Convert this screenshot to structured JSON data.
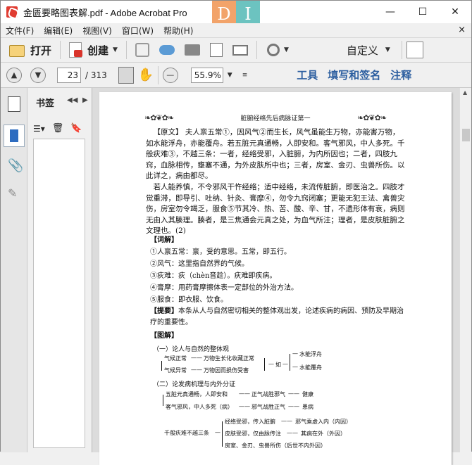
{
  "window": {
    "title": "金匮要略图表解.pdf - Adobe Acrobat Pro",
    "brand_letters": [
      "D",
      "I"
    ],
    "controls": {
      "minimize": "—",
      "maximize": "☐",
      "close": "✕"
    }
  },
  "menu": {
    "items": [
      "文件(F)",
      "编辑(E)",
      "视图(V)",
      "窗口(W)",
      "帮助(H)"
    ],
    "close": "×"
  },
  "toolbar": {
    "open_label": "打开",
    "create_label": "创建",
    "customize_label": "自定义"
  },
  "navbar": {
    "page_current": "23",
    "page_total": "/ 313",
    "zoom": "55.9%",
    "links": [
      "工具",
      "填写和签名",
      "注释"
    ]
  },
  "bookmarks": {
    "title": "书签"
  },
  "document": {
    "header_title": "脏腑经络先后病脉证第一",
    "para1": "【原文】 夫人禀五常①，因风气②而生长，风气虽能生万物，亦能害万物，如水能浮舟，亦能覆舟。若五脏元真通畅，人即安和。客气邪风，中人多死。千般疢难③，不越三条：一者，经络受邪，入脏腑，为内所因也；二者，四肢九窍，血脉相传，壅塞不通，为外皮肤所中也；三者，房室、金刃、虫兽所伤。以此详之，病由都尽。",
    "para2": "若人能养慎，不令邪风干忤经络；适中经络，未流传脏腑，即医治之。四肢才觉重滞，即导引、吐纳、针灸、膏摩④，勿令九窍闭塞；更能无犯王法、禽兽灾伤，房室勿令竭乏，服食⑤节其冷、热、苦、酸、辛、甘，不遗形体有衰，病则无由入其腠理。腠者，是三焦通会元真之处，为血气所注；理者，是皮肤脏腑之文理也。(2)",
    "notes_title": "【词解】",
    "notes": [
      "①人禀五常：禀，受的意思。五常，即五行。",
      "②风气：这里指自然界的气候。",
      "③疢难：疢（chèn音趁）。疢难即疾病。",
      "④膏摩：用药膏摩擦体表一定部位的外治方法。",
      "⑤服食：即衣服、饮食。"
    ],
    "summary_label": "【提要】",
    "summary": "本条从人与自然密切相关的整体观出发，论述疾病的病因、预防及早期治疗的重要性。",
    "diagram_title": "【图解】",
    "section1": "（一）论人与自然的整体观",
    "d1": {
      "a": "气候正常",
      "a_res": "万物生长化收藏正常",
      "b": "气候异常",
      "b_res": "万物因而损伤受害",
      "mid": "如",
      "r1": "水能浮舟",
      "r2": "水能覆舟"
    },
    "section2": "（二）论发病机理与内外分证",
    "d2": {
      "a": "五脏元真通畅，人即安和",
      "a_res": "正气战胜邪气",
      "a_end": "健康",
      "b": "客气邪风，中人多死（病）",
      "b_res": "邪气战胜正气",
      "b_end": "患病"
    },
    "d3": {
      "root": "千般疢难不越三条",
      "c1": "经络受邪，传入脏腑",
      "c1_res": "邪气乘虚入内（内因）",
      "c2": "皮肤受邪，仅由脉传注",
      "c2_res": "其病在外（外因）",
      "c3": "房室、金刃、虫兽所伤（后世不内外因）"
    }
  }
}
